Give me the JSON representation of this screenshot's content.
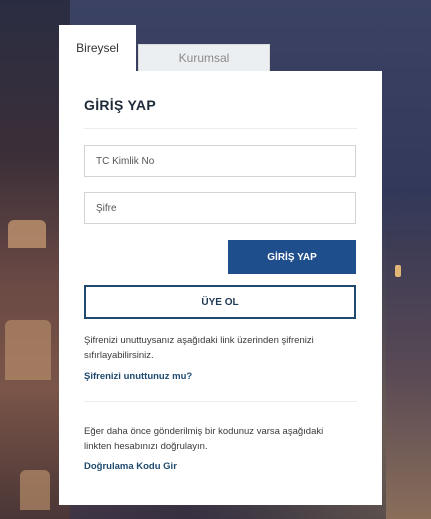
{
  "tabs": {
    "individual": "Bireysel",
    "corporate": "Kurumsal"
  },
  "login": {
    "title": "GİRİŞ YAP",
    "tc_placeholder": "TC Kimlik No",
    "password_placeholder": "Şifre",
    "login_button": "GİRİŞ YAP",
    "register_button": "ÜYE OL",
    "forgot_text": "Şifrenizi unuttuysanız aşağıdaki link üzerinden şifrenizi sıfırlayabilirsiniz.",
    "forgot_link": "Şifrenizi unuttunuz mu?",
    "verify_text": "Eğer daha önce gönderilmiş bir kodunuz varsa aşağıdaki linkten hesabınızı doğrulayın.",
    "verify_link": "Doğrulama Kodu Gir"
  },
  "colors": {
    "primary": "#1f4e8c",
    "outline": "#1f4a6e"
  }
}
